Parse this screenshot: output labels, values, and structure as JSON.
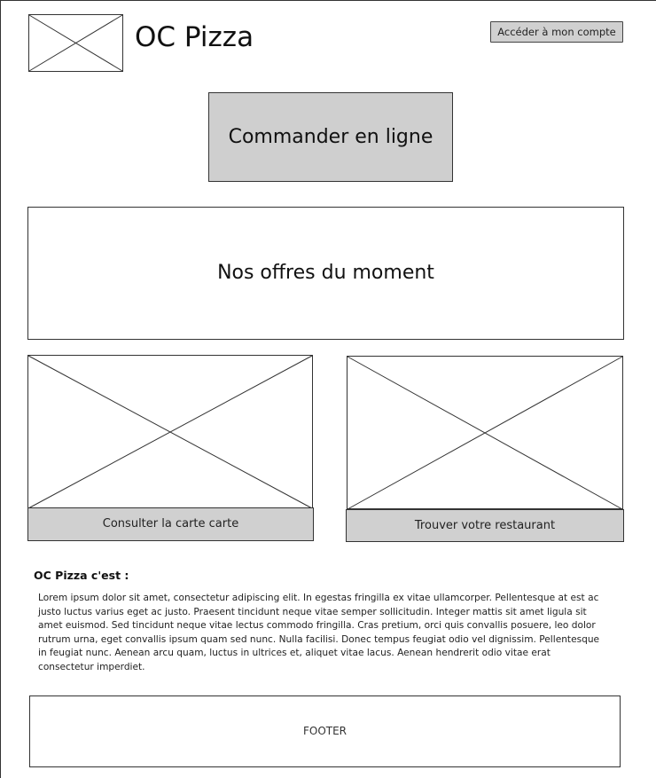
{
  "header": {
    "logo_icon": "image-placeholder-icon",
    "title": "OC Pizza",
    "account_button_label": "Accéder à mon compte"
  },
  "main": {
    "order_button_label": "Commander en ligne",
    "offers_label": "Nos offres du moment",
    "cards": [
      {
        "image_icon": "image-placeholder-icon",
        "button_label": "Consulter la carte carte"
      },
      {
        "image_icon": "image-placeholder-icon",
        "button_label": "Trouver votre restaurant"
      }
    ]
  },
  "about": {
    "heading": "OC Pizza c'est :",
    "body": "Lorem ipsum dolor sit amet, consectetur adipiscing elit. In egestas fringilla ex vitae ullamcorper. Pellentesque at est ac justo luctus varius eget ac justo. Praesent tincidunt neque vitae semper sollicitudin. Integer mattis sit amet ligula sit amet euismod. Sed tincidunt neque vitae lectus commodo fringilla. Cras pretium, orci quis convallis posuere, leo dolor rutrum urna, eget convallis ipsum quam sed nunc. Nulla facilisi. Donec tempus feugiat odio vel dignissim. Pellentesque in feugiat nunc. Aenean arcu quam, luctus in ultrices et, aliquet vitae lacus. Aenean hendrerit odio vitae erat consectetur imperdiet."
  },
  "footer": {
    "label": "FOOTER"
  },
  "colors": {
    "button_fill": "#d0d0d0",
    "border": "#333333",
    "background": "#ffffff"
  }
}
